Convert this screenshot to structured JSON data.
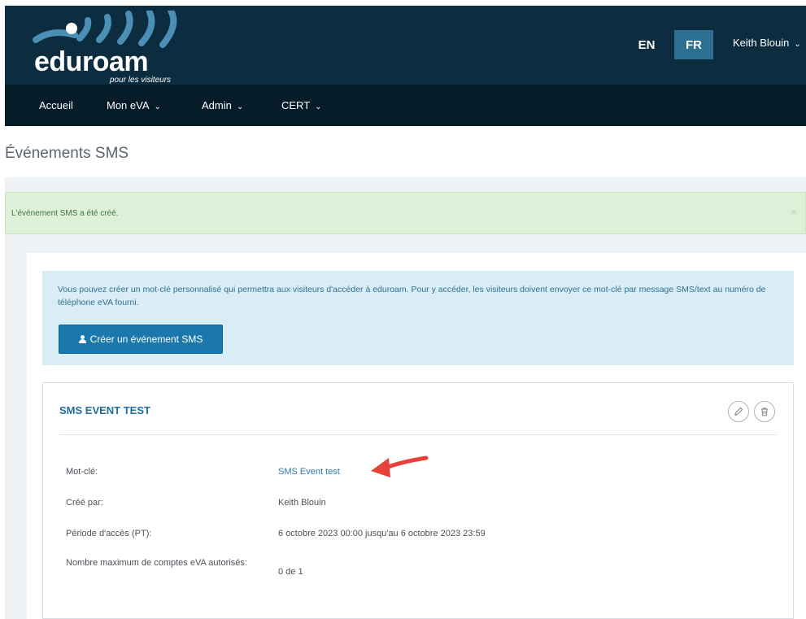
{
  "header": {
    "logo_text_edu": "edu",
    "logo_text_roam": "roam",
    "logo_subtitle": "pour les visiteurs",
    "lang_en": "EN",
    "lang_fr": "FR",
    "user_name": "Keith Blouin"
  },
  "nav": {
    "items": [
      {
        "label": "Accueil"
      },
      {
        "label": "Mon eVA"
      },
      {
        "label": "Admin"
      },
      {
        "label": "CERT"
      }
    ]
  },
  "page": {
    "title": "Événements SMS"
  },
  "alert": {
    "message": "L'événement SMS a été créé.",
    "close": "×"
  },
  "info": {
    "text": "Vous pouvez créer un mot-clé personnalisé qui permettra aux visiteurs d'accéder à eduroam. Pour y accéder, les visiteurs doivent envoyer ce mot-clé par message SMS/text au numéro de téléphone eVA fourni.",
    "create_button": "Créer un événement SMS"
  },
  "event": {
    "title": "SMS EVENT TEST",
    "rows": [
      {
        "label": "Mot-clé:",
        "value": "SMS Event test"
      },
      {
        "label": "Créé par:",
        "value": "Keith Blouin"
      },
      {
        "label": "Période d'accès (PT):",
        "value": "6 octobre 2023 00:00 jusqu'au 6 octobre 2023 23:59"
      },
      {
        "label": "Nombre maximum de comptes eVA autorisés:",
        "value": "0 de 1"
      }
    ]
  },
  "colors": {
    "header_bg": "#0c2d3f",
    "nav_bg": "#061c29",
    "accent": "#1a78ac",
    "alert_bg": "#dff0d8",
    "info_bg": "#d9edf7",
    "annotation_arrow": "#e8403a"
  }
}
